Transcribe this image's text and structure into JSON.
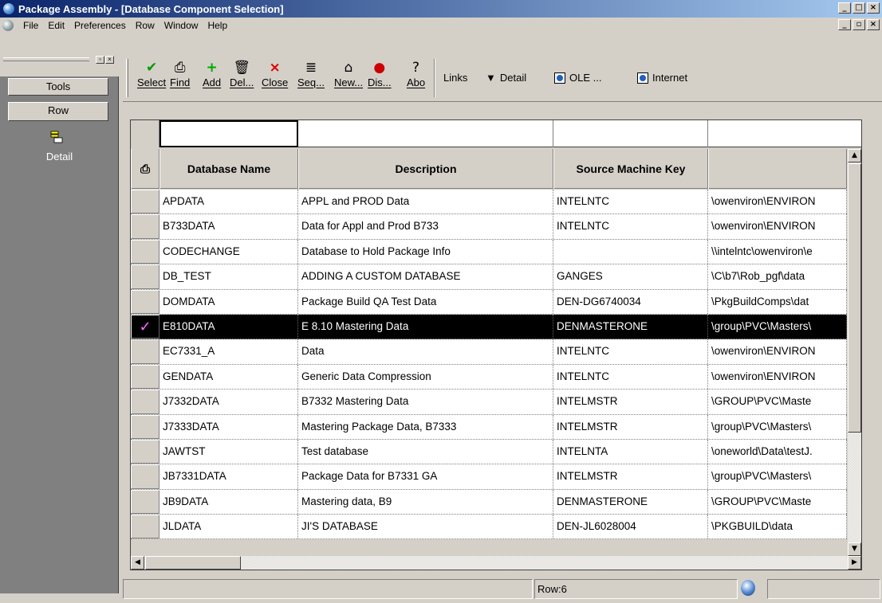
{
  "window": {
    "title": "Package Assembly - [Database Component Selection]",
    "controls": [
      "_",
      "□",
      "×"
    ],
    "mdi_controls": [
      "_",
      "▫",
      "×"
    ]
  },
  "menu": [
    "File",
    "Edit",
    "Preferences",
    "Row",
    "Window",
    "Help"
  ],
  "left_pane": {
    "tabs": [
      "Tools",
      "Row"
    ],
    "detail_label": "Detail",
    "mini_controls": [
      "▫",
      "×"
    ]
  },
  "toolbar": {
    "buttons": [
      {
        "label": "Select",
        "icon": "check-icon"
      },
      {
        "label": "Find",
        "icon": "find-icon"
      },
      {
        "label": "Add",
        "icon": "add-icon"
      },
      {
        "label": "Del...",
        "icon": "trash-icon"
      },
      {
        "label": "Close",
        "icon": "close-icon"
      },
      {
        "label": "Seq...",
        "icon": "sequence-icon"
      },
      {
        "label": "New...",
        "icon": "new-icon"
      },
      {
        "label": "Dis...",
        "icon": "display-icon"
      },
      {
        "label": "Abo",
        "icon": "about-icon"
      }
    ],
    "links_label": "Links",
    "detail_label": "Detail",
    "ole_label": "OLE ...",
    "internet_label": "Internet"
  },
  "grid": {
    "columns": [
      "Database Name",
      "Description",
      "Source Machine Key",
      ""
    ],
    "rows": [
      [
        "APDATA",
        "APPL and PROD Data",
        "INTELNTC",
        "\\owenviron\\ENVIRON"
      ],
      [
        "B733DATA",
        "Data for Appl and Prod B733",
        "INTELNTC",
        "\\owenviron\\ENVIRON"
      ],
      [
        "CODECHANGE",
        "Database to Hold Package Info",
        "",
        "\\\\intelntc\\owenviron\\e"
      ],
      [
        "DB_TEST",
        "ADDING A CUSTOM DATABASE",
        "GANGES",
        "\\C\\b7\\Rob_pgf\\data"
      ],
      [
        "DOMDATA",
        "Package Build QA Test Data",
        "DEN-DG6740034",
        "\\PkgBuildComps\\dat"
      ],
      [
        "E810DATA",
        "E 8.10 Mastering Data",
        "DENMASTERONE",
        "\\group\\PVC\\Masters\\"
      ],
      [
        "EC7331_A",
        "Data",
        "INTELNTC",
        "\\owenviron\\ENVIRON"
      ],
      [
        "GENDATA",
        "Generic Data Compression",
        "INTELNTC",
        "\\owenviron\\ENVIRON"
      ],
      [
        "J7332DATA",
        "B7332 Mastering Data",
        "INTELMSTR",
        "\\GROUP\\PVC\\Maste"
      ],
      [
        "J7333DATA",
        "Mastering Package Data, B7333",
        "INTELMSTR",
        "\\group\\PVC\\Masters\\"
      ],
      [
        "JAWTST",
        "Test database",
        "INTELNTA",
        "\\oneworld\\Data\\testJ."
      ],
      [
        "JB7331DATA",
        "Package Data for B7331 GA",
        "INTELMSTR",
        "\\group\\PVC\\Masters\\"
      ],
      [
        "JB9DATA",
        "Mastering data, B9",
        "DENMASTERONE",
        "\\GROUP\\PVC\\Maste"
      ],
      [
        "JLDATA",
        "JI'S DATABASE",
        "DEN-JL6028004",
        "\\PKGBUILD\\data"
      ]
    ],
    "selected_row_index": 5,
    "selected_mark": "✓"
  },
  "status": {
    "row_text": "Row:6"
  }
}
